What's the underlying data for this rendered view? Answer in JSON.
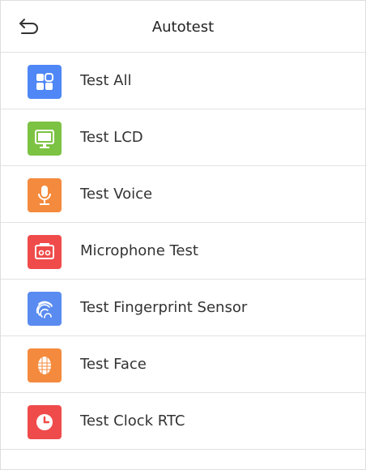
{
  "header": {
    "title": "Autotest"
  },
  "items": [
    {
      "key": "test-all",
      "label": "Test All",
      "icon": "grid-icon",
      "color": "#4f87f6"
    },
    {
      "key": "test-lcd",
      "label": "Test LCD",
      "icon": "monitor-icon",
      "color": "#7cc243"
    },
    {
      "key": "test-voice",
      "label": "Test Voice",
      "icon": "microphone-icon",
      "color": "#f48a3d"
    },
    {
      "key": "microphone-test",
      "label": "Microphone Test",
      "icon": "cassette-icon",
      "color": "#ef4b4b"
    },
    {
      "key": "test-fingerprint-sensor",
      "label": "Test Fingerprint Sensor",
      "icon": "fingerprint-icon",
      "color": "#5a8bf0"
    },
    {
      "key": "test-face",
      "label": "Test Face",
      "icon": "face-icon",
      "color": "#f48a3d"
    },
    {
      "key": "test-clock-rtc",
      "label": "Test Clock RTC",
      "icon": "clock-icon",
      "color": "#ef4b4b"
    }
  ]
}
